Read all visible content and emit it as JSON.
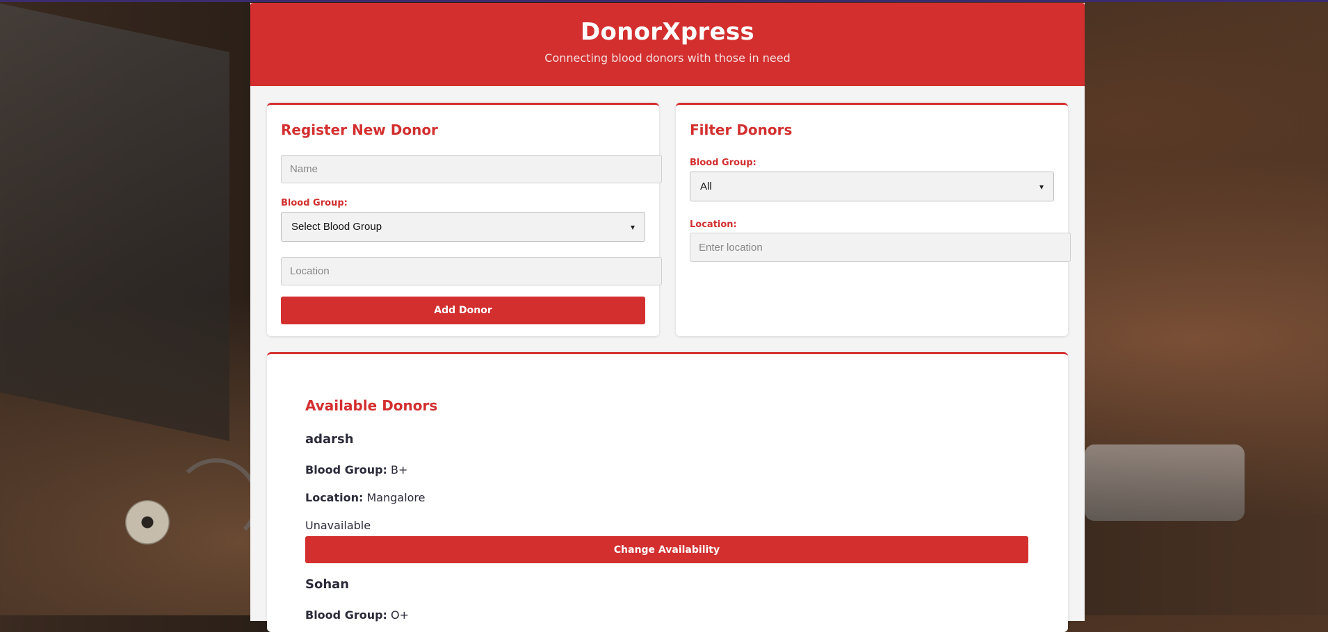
{
  "app": {
    "title": "DonorXpress",
    "tagline": "Connecting blood donors with those in need"
  },
  "register": {
    "heading": "Register New Donor",
    "name_placeholder": "Name",
    "blood_group_label": "Blood Group:",
    "blood_group_selected": "Select Blood Group",
    "location_placeholder": "Location",
    "add_button": "Add Donor"
  },
  "filter": {
    "heading": "Filter Donors",
    "blood_group_label": "Blood Group:",
    "blood_group_selected": "All",
    "location_label": "Location:",
    "location_placeholder": "Enter location"
  },
  "donors": {
    "heading": "Available Donors",
    "blood_group_label": "Blood Group:",
    "location_label": "Location:",
    "change_button": "Change Availability",
    "list": [
      {
        "name": "adarsh",
        "blood_group": "B+",
        "location": "Mangalore",
        "status": "Unavailable"
      },
      {
        "name": "Sohan",
        "blood_group": "O+"
      }
    ]
  },
  "colors": {
    "accent": "#d32f2f",
    "header_bg": "#d32f2f",
    "panel_bg": "#f4f4f4",
    "text_dark": "#2b2b3a"
  }
}
